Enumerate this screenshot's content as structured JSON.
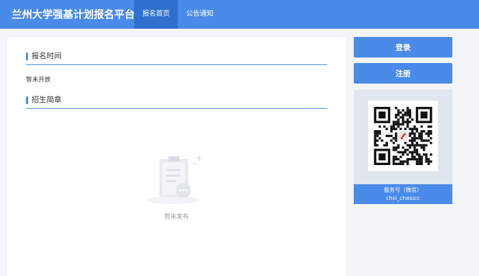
{
  "header": {
    "site_title": "兰州大学强基计划报名平台",
    "nav": [
      {
        "label": "报名首页",
        "active": true
      },
      {
        "label": "公告通知",
        "active": false
      }
    ]
  },
  "main": {
    "section_registration": {
      "title": "报名时间",
      "status": "暂未开放"
    },
    "section_brochure": {
      "title": "招生简章",
      "empty_text": "暂未发布"
    }
  },
  "sidebar": {
    "login_label": "登录",
    "register_label": "注册",
    "qr": {
      "caption_line1": "服务号（微信）",
      "caption_line2": "chsi_chesicc"
    }
  },
  "colors": {
    "accent": "#4a8ae8",
    "nav_active": "#2f70cf",
    "page_bg": "#f3f5f8"
  },
  "icons": [
    "clipboard-empty-icon",
    "wechat-qr-code"
  ]
}
